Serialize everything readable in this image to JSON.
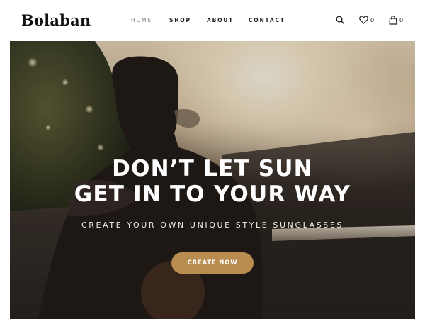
{
  "header": {
    "logo": "Bolaban",
    "nav": [
      "HOME",
      "SHOP",
      "ABOUT",
      "CONTACT"
    ],
    "active_nav": "HOME",
    "wishlist_count": "0",
    "cart_count": "0",
    "icons": [
      "search-icon",
      "heart-icon",
      "shopping-bag-icon"
    ]
  },
  "hero": {
    "title_line1": "DON’T LET SUN",
    "title_line2": "GET IN TO YOUR WAY",
    "subtitle": "CREATE YOUR OWN UNIQUE STYLE SUNGLASSES",
    "cta_label": "CREATE NOW"
  },
  "colors": {
    "accent": "#b98d50",
    "text": "#111111",
    "nav_active": "#8a8a8a",
    "background": "#ffffff"
  }
}
